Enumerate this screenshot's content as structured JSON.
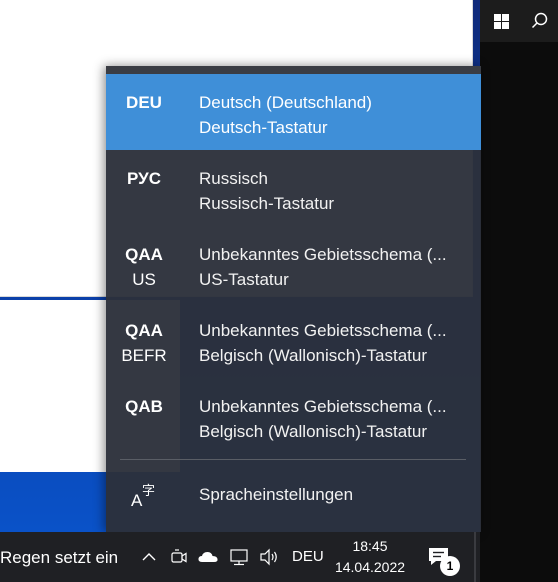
{
  "language_flyout": {
    "items": [
      {
        "code": "DEU",
        "subcode": "",
        "name": "Deutsch (Deutschland)",
        "keyboard": "Deutsch-Tastatur",
        "selected": true
      },
      {
        "code": "РУС",
        "subcode": "",
        "name": "Russisch",
        "keyboard": "Russisch-Tastatur",
        "selected": false
      },
      {
        "code": "QAA",
        "subcode": "US",
        "name": "Unbekanntes Gebietsschema (...",
        "keyboard": "US-Tastatur",
        "selected": false
      },
      {
        "code": "QAA",
        "subcode": "BEFR",
        "name": "Unbekanntes Gebietsschema (...",
        "keyboard": "Belgisch (Wallonisch)-Tastatur",
        "selected": false
      },
      {
        "code": "QAB",
        "subcode": "",
        "name": "Unbekanntes Gebietsschema (...",
        "keyboard": "Belgisch (Wallonisch)-Tastatur",
        "selected": false
      }
    ],
    "settings_label": "Spracheinstellungen",
    "settings_icon": "language-settings-icon",
    "selected_color": "#3f8fd8"
  },
  "taskbar": {
    "weather_text": "Regen setzt ein",
    "language_indicator": "DEU",
    "time": "18:45",
    "date": "14.04.2022",
    "notification_count": "1",
    "icons": [
      "chevron-up-icon",
      "meet-now-icon",
      "onedrive-cloud-icon",
      "network-icon",
      "volume-icon",
      "action-center-icon"
    ]
  },
  "right_strip": {
    "icons": [
      "windows-start-icon",
      "search-icon"
    ]
  }
}
